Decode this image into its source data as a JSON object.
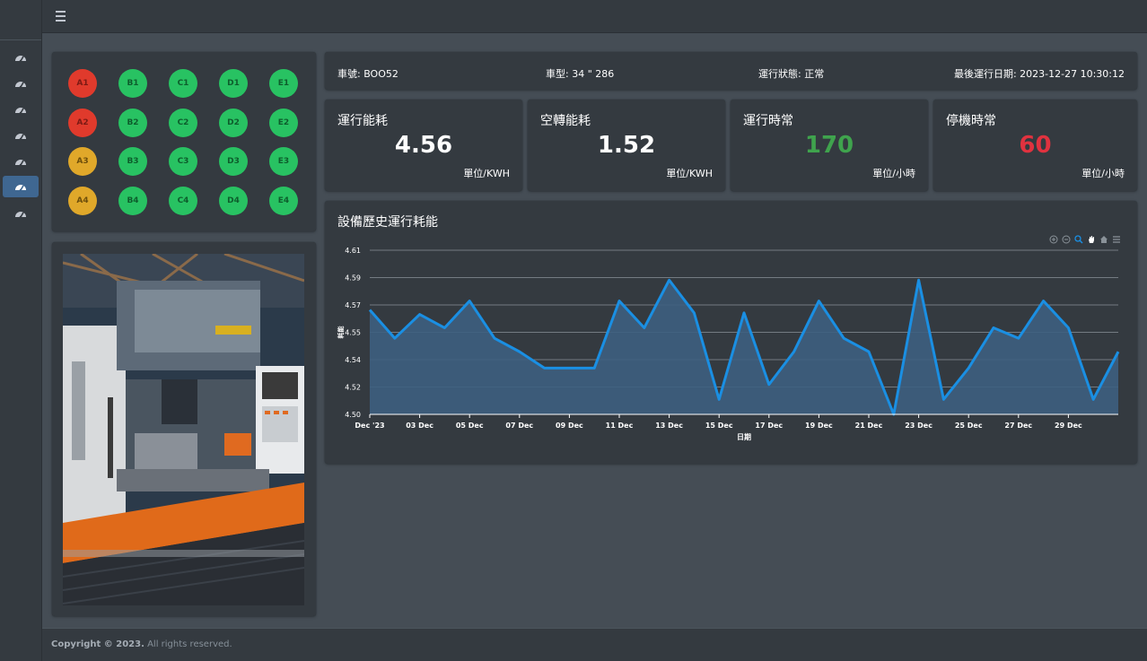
{
  "sidebar": {
    "items": [
      {
        "icon": "gauge-icon",
        "active": false
      },
      {
        "icon": "gauge-icon",
        "active": false
      },
      {
        "icon": "gauge-icon",
        "active": false
      },
      {
        "icon": "gauge-icon",
        "active": false
      },
      {
        "icon": "gauge-icon",
        "active": false
      },
      {
        "icon": "gauge-icon",
        "active": true
      },
      {
        "icon": "gauge-icon",
        "active": false
      }
    ]
  },
  "topbar": {
    "menu_icon": "hamburger-icon"
  },
  "sensors": {
    "rows": [
      [
        {
          "label": "A1",
          "status": "red"
        },
        {
          "label": "B1",
          "status": "green"
        },
        {
          "label": "C1",
          "status": "green"
        },
        {
          "label": "D1",
          "status": "green"
        },
        {
          "label": "E1",
          "status": "green"
        }
      ],
      [
        {
          "label": "A2",
          "status": "red"
        },
        {
          "label": "B2",
          "status": "green"
        },
        {
          "label": "C2",
          "status": "green"
        },
        {
          "label": "D2",
          "status": "green"
        },
        {
          "label": "E2",
          "status": "green"
        }
      ],
      [
        {
          "label": "A3",
          "status": "yellow"
        },
        {
          "label": "B3",
          "status": "green"
        },
        {
          "label": "C3",
          "status": "green"
        },
        {
          "label": "D3",
          "status": "green"
        },
        {
          "label": "E3",
          "status": "green"
        }
      ],
      [
        {
          "label": "A4",
          "status": "yellow"
        },
        {
          "label": "B4",
          "status": "green"
        },
        {
          "label": "C4",
          "status": "green"
        },
        {
          "label": "D4",
          "status": "green"
        },
        {
          "label": "E4",
          "status": "green"
        }
      ]
    ],
    "colors": {
      "green": "#28c262",
      "red": "#e03a2c",
      "yellow": "#e0a82a"
    }
  },
  "info": {
    "vehicle_no": "車號: BOO52",
    "vehicle_type": "車型: 34 \" 286",
    "status": "運行狀態: 正常",
    "last_run": "最後運行日期: 2023-12-27 10:30:12"
  },
  "metrics": [
    {
      "title": "運行能耗",
      "value": "4.56",
      "unit": "單位/KWH",
      "color": "#ffffff"
    },
    {
      "title": "空轉能耗",
      "value": "1.52",
      "unit": "單位/KWH",
      "color": "#ffffff"
    },
    {
      "title": "運行時常",
      "value": "170",
      "unit": "單位/小時",
      "color": "#3fa34d"
    },
    {
      "title": "停機時常",
      "value": "60",
      "unit": "單位/小時",
      "color": "#e0323f"
    }
  ],
  "chart_title": "設備歷史運行耗能",
  "chart_data": {
    "type": "area",
    "xlabel": "日期",
    "ylabel": "耗能",
    "ylim": [
      4.5,
      4.61
    ],
    "yticks": [
      "4.61",
      "4.59",
      "4.57",
      "4.55",
      "4.54",
      "4.52",
      "4.50"
    ],
    "xticks": [
      "Dec '23",
      "03 Dec",
      "05 Dec",
      "07 Dec",
      "09 Dec",
      "11 Dec",
      "13 Dec",
      "15 Dec",
      "17 Dec",
      "19 Dec",
      "21 Dec",
      "23 Dec",
      "25 Dec",
      "27 Dec",
      "29 Dec"
    ],
    "x": [
      "2023-12-01",
      "2023-12-02",
      "2023-12-03",
      "2023-12-04",
      "2023-12-05",
      "2023-12-06",
      "2023-12-07",
      "2023-12-08",
      "2023-12-09",
      "2023-12-10",
      "2023-12-11",
      "2023-12-12",
      "2023-12-13",
      "2023-12-14",
      "2023-12-15",
      "2023-12-16",
      "2023-12-17",
      "2023-12-18",
      "2023-12-19",
      "2023-12-20",
      "2023-12-21",
      "2023-12-22",
      "2023-12-23",
      "2023-12-24",
      "2023-12-25",
      "2023-12-26",
      "2023-12-27",
      "2023-12-28",
      "2023-12-29",
      "2023-12-30",
      "2023-12-31"
    ],
    "values": [
      4.57,
      4.551,
      4.567,
      4.558,
      4.576,
      4.551,
      4.542,
      4.531,
      4.531,
      4.531,
      4.576,
      4.558,
      4.59,
      4.568,
      4.51,
      4.568,
      4.52,
      4.542,
      4.576,
      4.551,
      4.542,
      4.5,
      4.59,
      4.51,
      4.531,
      4.558,
      4.551,
      4.576,
      4.558,
      4.51,
      4.542
    ],
    "line_color": "#1a8fe3",
    "fill_color": "#3d5f80",
    "grid": true
  },
  "footer": {
    "copyright_bold": "Copyright © 2023.",
    "copyright_rest": " All rights reserved."
  }
}
